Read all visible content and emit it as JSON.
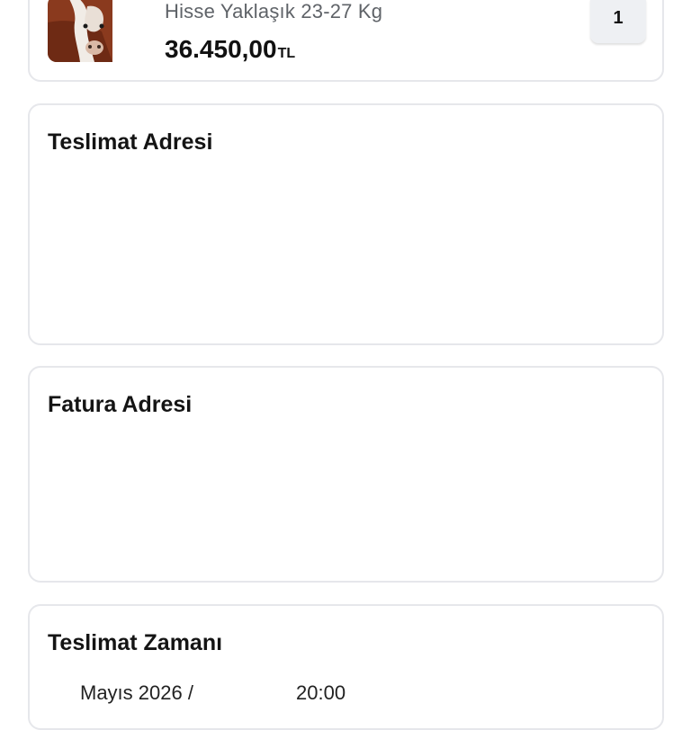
{
  "product": {
    "subtitle": "Hisse Yaklaşık 23-27 Kg",
    "price": "36.450,00",
    "currency": "TL",
    "quantity": "1",
    "image_icon": "cow-photo"
  },
  "delivery_address": {
    "title": "Teslimat Adresi"
  },
  "invoice_address": {
    "title": "Fatura Adresi"
  },
  "delivery_time": {
    "title": "Teslimat Zamanı",
    "date": "Mayıs 2026 /",
    "time": "20:00"
  },
  "colors": {
    "card_border": "#e6e7eb",
    "quantity_bg": "#eef0f3",
    "subtitle": "#5f6368"
  }
}
